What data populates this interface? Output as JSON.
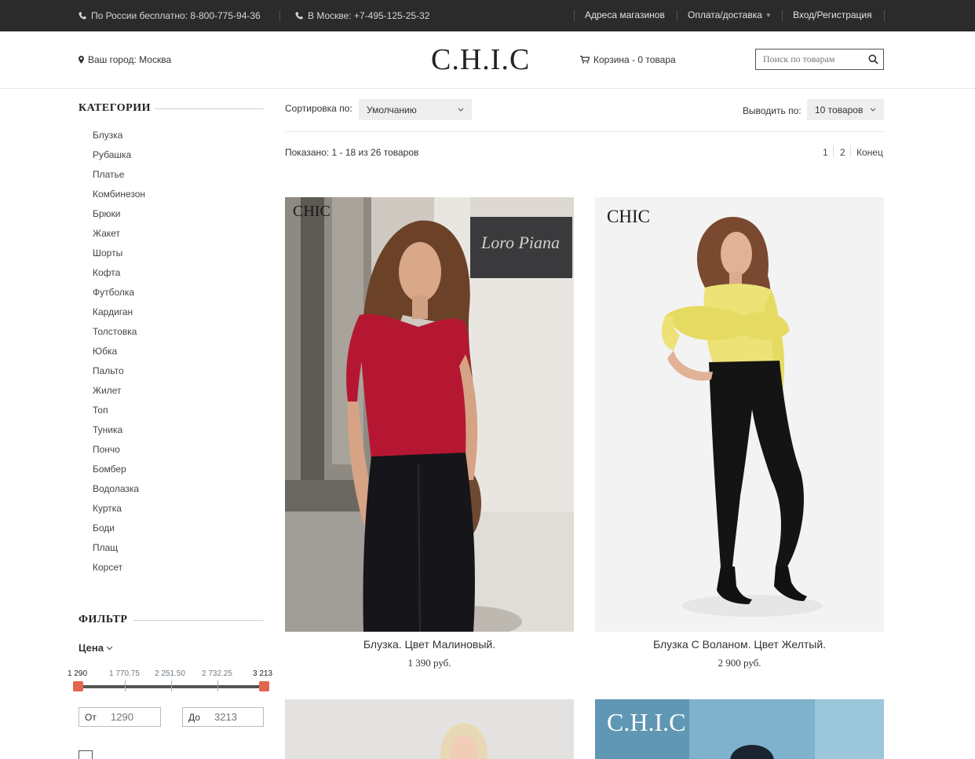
{
  "topbar": {
    "phone_russia": "По России бесплатно: 8-800-775-94-36",
    "phone_moscow": "В Москве: +7-495-125-25-32",
    "nav": {
      "stores": "Адреса магазинов",
      "payment": "Оплата/доставка",
      "login": "Вход/Регистрация"
    }
  },
  "header": {
    "city": "Ваш город: Москва",
    "logo": "C.H.I.C",
    "cart": "Корзина - 0 товара",
    "search_placeholder": "Поиск по товарам"
  },
  "sidebar": {
    "categories_title": "КАТЕГОРИИ",
    "categories": [
      "Блузка",
      "Рубашка",
      "Платье",
      "Комбинезон",
      "Брюки",
      "Жакет",
      "Шорты",
      "Кофта",
      "Футболка",
      "Кардиган",
      "Толстовка",
      "Юбка",
      "Пальто",
      "Жилет",
      "Топ",
      "Туника",
      "Пончо",
      "Бомбер",
      "Водолазка",
      "Куртка",
      "Боди",
      "Плащ",
      "Корсет"
    ],
    "filter_title": "ФИЛЬТР",
    "price": {
      "label": "Цена",
      "ticks": [
        "1 290",
        "1 770.75",
        "2 251.50",
        "2 732.25",
        "3 213"
      ],
      "from_label": "От",
      "from_value": "1290",
      "to_label": "До",
      "to_value": "3213",
      "selected_range": [
        1290,
        3213
      ]
    }
  },
  "toolbar": {
    "sort_label": "Сортировка по:",
    "sort_value": "Умолчанию",
    "per_page_label": "Выводить по:",
    "per_page_value": "10 товаров",
    "shown": "Показано: 1 - 18 из 26 товаров",
    "pages": [
      "1",
      "2"
    ],
    "last": "Конец"
  },
  "products": [
    {
      "brand": "CHIC",
      "name": "Блузка. Цвет Малиновый.",
      "price": "1 390 руб."
    },
    {
      "brand": "CHIC",
      "name": "Блузка С Воланом. Цвет Желтый.",
      "price": "2 900 руб."
    },
    {
      "brand": "",
      "name": "",
      "price": ""
    },
    {
      "brand": "C.H.I.C",
      "name": "",
      "price": ""
    }
  ],
  "colors": {
    "topbar": "#2b2b2b",
    "slider_handle": "#e2654e",
    "select_bg": "#eeeeee"
  }
}
